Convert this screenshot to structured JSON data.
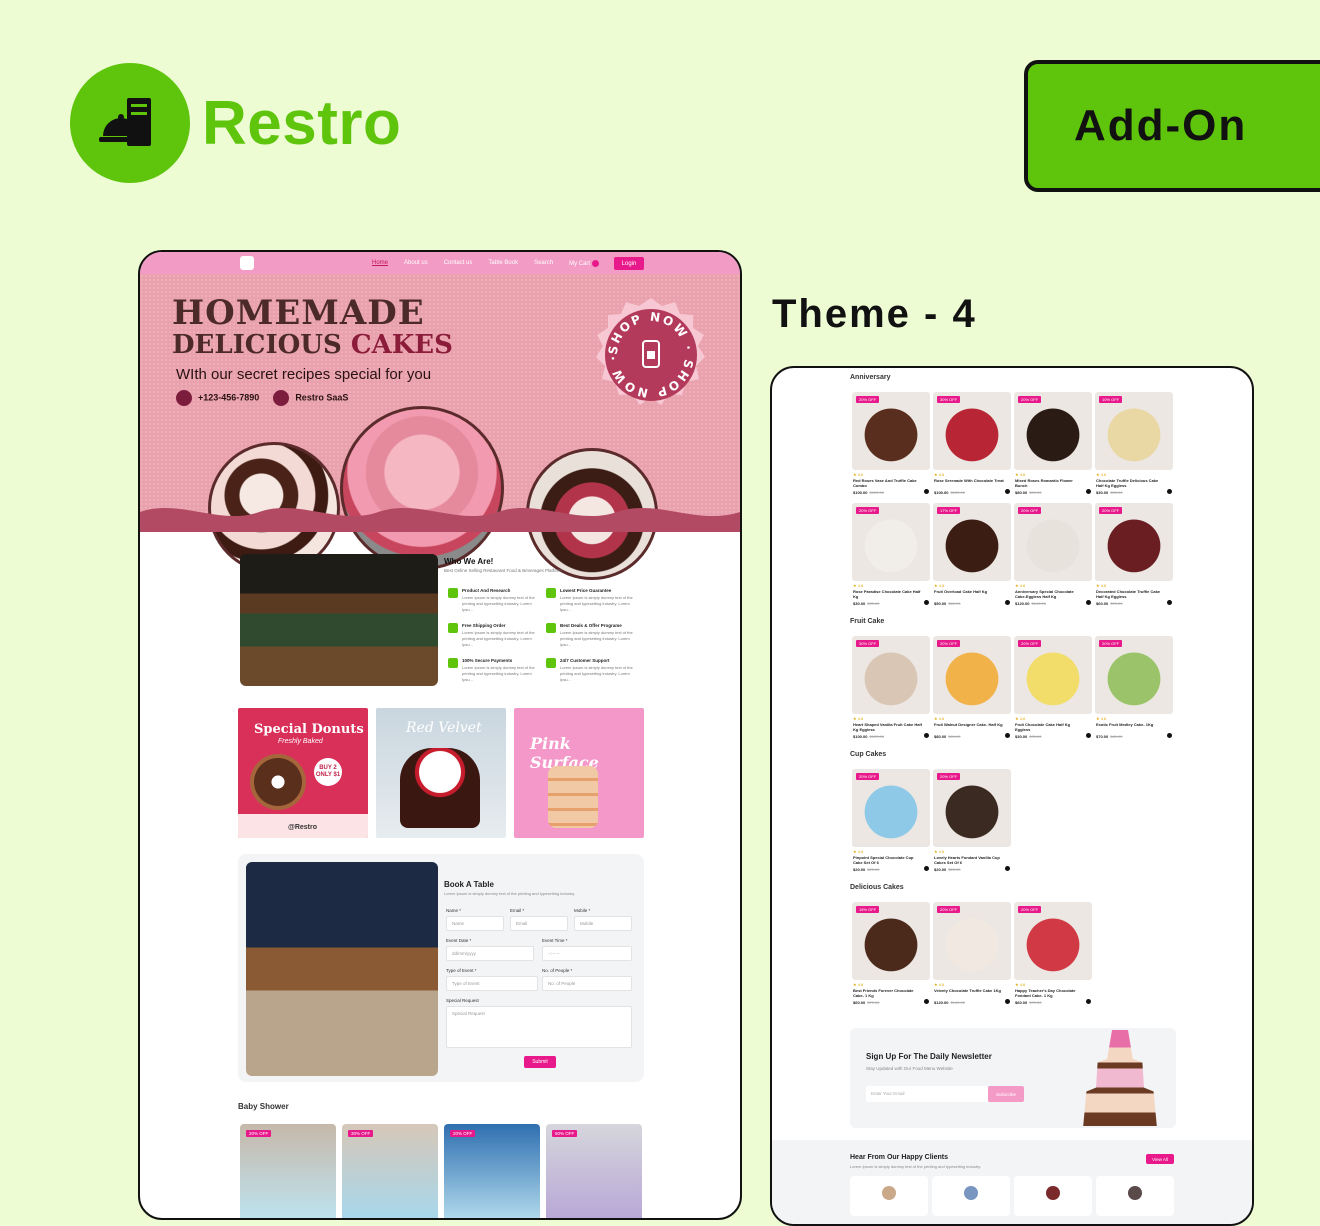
{
  "brand": {
    "name": "Restro",
    "accent": "#5fc40c",
    "icon": "restaurant-cloche-icon"
  },
  "addon_label": "Add-On",
  "theme_label": "Theme - 4",
  "colors": {
    "pink_primary": "#e8198b",
    "hero_bg": "#e9a1ad",
    "nav_bg": "#f29bc4",
    "page_bg": "#eefcd4"
  },
  "left": {
    "nav": {
      "items": [
        "Home",
        "About us",
        "Contact us",
        "Table Book",
        "Search",
        "My Cart"
      ],
      "active": "Home",
      "login": "Login"
    },
    "hero": {
      "line1": "HOMEMADE",
      "line2a": "DELICIOUS",
      "line2b": "CAKES",
      "sub": "WIth our secret recipes special for you",
      "phone": "+123-456-7890",
      "site": "Restro SaaS",
      "badge_text": "SHOP NOW · SHOP NOW ·"
    },
    "who": {
      "title": "Who We Are!",
      "subtitle": "Best Online Selling Restaurant Food & Beverages Platform",
      "features": [
        {
          "title": "Product And Research",
          "text": "Lorem Ipsum is simply dummy text of the printing and typesetting industry. Lorem Ipsu..."
        },
        {
          "title": "Lowest Price Guarantee",
          "text": "Lorem Ipsum is simply dummy text of the printing and typesetting industry. Lorem Ipsu..."
        },
        {
          "title": "Free Shipping Order",
          "text": "Lorem Ipsum is simply dummy text of the printing and typesetting industry. Lorem Ipsu..."
        },
        {
          "title": "Best Deals & Offer Programe",
          "text": "Lorem Ipsum is simply dummy text of the printing and typesetting industry. Lorem Ipsu..."
        },
        {
          "title": "100% Secure Payments",
          "text": "Lorem Ipsum is simply dummy text of the printing and typesetting industry. Lorem Ipsu..."
        },
        {
          "title": "24/7 Customer Support",
          "text": "Lorem Ipsum is simply dummy text of the printing and typesetting industry. Lorem Ipsu..."
        }
      ]
    },
    "promos": {
      "donut_title": "Special Donuts",
      "donut_sub": "Freshly Baked",
      "donut_offer1": "BUY 2",
      "donut_offer2": "ONLY $1",
      "donut_handle": "@Restro",
      "velvet_title": "Red Velvet",
      "pink_title": "Pink Surface"
    },
    "booking": {
      "title": "Book A Table",
      "desc": "Lorem Ipsum is simply dummy text of the printing and typesetting industry.",
      "name_label": "Name *",
      "name_ph": "Name",
      "email_label": "Email *",
      "email_ph": "Email",
      "mobile_label": "Mobile *",
      "mobile_ph": "Mobile",
      "date_label": "Event Date *",
      "date_ph": "dd/mm/yyyy",
      "time_label": "Event Time *",
      "time_ph": "--:-- --",
      "type_label": "Type of Event *",
      "type_ph": "Type of Event",
      "people_label": "No. of People *",
      "people_ph": "No. of People",
      "request_label": "Special Request",
      "request_ph": "Special Request",
      "submit": "Submit"
    },
    "baby_shower": {
      "title": "Baby Shower",
      "badges": [
        "20% OFF",
        "30% OFF",
        "20% OFF",
        "50% OFF"
      ]
    }
  },
  "right": {
    "categories": [
      {
        "title": "Anniversary",
        "products": [
          {
            "badge": "20% OFF",
            "rating": "★ 4.6",
            "name": "Red Roses Vase And Truffle Cake Combo",
            "price": "$100.00",
            "old": "$120.00"
          },
          {
            "badge": "30% OFF",
            "rating": "★ 4.6",
            "name": "Rose Serenade With Chocolate Treat",
            "price": "$100.00",
            "old": "$120.00"
          },
          {
            "badge": "20% OFF",
            "rating": "★ 4.6",
            "name": "Mixed Roses Romantic Flower Bunch",
            "price": "$80.00",
            "old": "$90.00"
          },
          {
            "badge": "10% OFF",
            "rating": "★ 4.6",
            "name": "Chocolate Truffle Delicious Cake Half Kg Eggless",
            "price": "$30.00",
            "old": "$35.00"
          },
          {
            "badge": "20% OFF",
            "rating": "★ 4.6",
            "name": "Rose Paradise Chocolate Cake Half Kg",
            "price": "$30.00",
            "old": "$35.00"
          },
          {
            "badge": "17% OFF",
            "rating": "★ 4.6",
            "name": "Fruit Overload Cake Half Kg",
            "price": "$50.00",
            "old": "$60.00"
          },
          {
            "badge": "20% OFF",
            "rating": "★ 4.6",
            "name": "Anniversary Special Chocolate Cake-Eggless Half Kg",
            "price": "$120.00",
            "old": "$140.00"
          },
          {
            "badge": "20% OFF",
            "rating": "★ 4.6",
            "name": "Decorated Chocolate Truffle Cake Half Kg Eggless",
            "price": "$60.00",
            "old": "$70.00"
          }
        ]
      },
      {
        "title": "Fruit Cake",
        "products": [
          {
            "badge": "30% OFF",
            "rating": "★ 4.6",
            "name": "Heart Shaped Vanilla Fruit Cake Half Kg Eggless",
            "price": "$100.00",
            "old": "$120.00"
          },
          {
            "badge": "20% OFF",
            "rating": "★ 4.6",
            "name": "Fruit Walnut Designer Cake- Half Kg",
            "price": "$80.00",
            "old": "$90.00"
          },
          {
            "badge": "20% OFF",
            "rating": "★ 4.6",
            "name": "Fruit Chocolate Cake Half Kg Eggless",
            "price": "$30.00",
            "old": "$35.00"
          },
          {
            "badge": "20% OFF",
            "rating": "★ 4.6",
            "name": "Exotic Fruit Medley Cake- 1Kg",
            "price": "$70.00",
            "old": "$80.00"
          }
        ]
      },
      {
        "title": "Cup Cakes",
        "products": [
          {
            "badge": "20% OFF",
            "rating": "★ 4.6",
            "name": "Pinpoint Special Chocolate Cup Cake Set Of 6",
            "price": "$20.00",
            "old": "$25.00"
          },
          {
            "badge": "20% OFF",
            "rating": "★ 4.6",
            "name": "Lovely Hearts Fondant Vanilla Cup Cakes Set Of 6",
            "price": "$20.00",
            "old": "$25.00"
          }
        ]
      },
      {
        "title": "Delicious Cakes",
        "products": [
          {
            "badge": "15% OFF",
            "rating": "★ 4.6",
            "name": "Best Friends Forever Chocolate Cake- 1 Kg",
            "price": "$60.00",
            "old": "$70.00"
          },
          {
            "badge": "20% OFF",
            "rating": "★ 4.6",
            "name": "Velvety Chocolate Truffle Cake 1Kg",
            "price": "$120.00",
            "old": "$140.00"
          },
          {
            "badge": "20% OFF",
            "rating": "★ 4.6",
            "name": "Happy Teacher's Day Chocolate Fondant Cake- 1 Kg",
            "price": "$60.00",
            "old": "$70.00"
          }
        ]
      }
    ],
    "newsletter": {
      "title": "Sign Up For The Daily Newsletter",
      "sub": "Stay Updated with Our Food Menu Website",
      "placeholder": "Enter Your Email",
      "button": "Subscribe"
    },
    "testimonials": {
      "title": "Hear From Our Happy Clients",
      "sub": "Lorem Ipsum is simply dummy text of the printing and typesetting industry.",
      "view_all": "View All"
    }
  }
}
